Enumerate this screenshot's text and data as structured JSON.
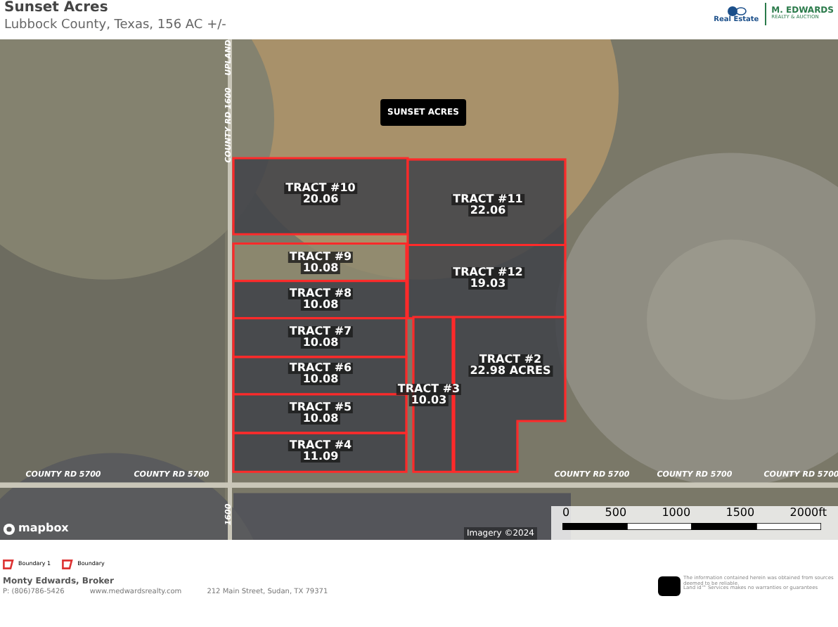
{
  "header": {
    "title": "Sunset Acres",
    "subtitle": "Lubbock County, Texas, 156 AC +/-",
    "logo_left": "Real Estate",
    "logo_right": [
      "M. EDWARDS",
      "REALTY & AUCTION"
    ]
  },
  "map": {
    "place_label": "SUNSET ACRES",
    "tracts": [
      {
        "name": "TRACT #10",
        "acres": "20.06"
      },
      {
        "name": "TRACT #11",
        "acres": "22.06"
      },
      {
        "name": "TRACT #9",
        "acres": "10.08"
      },
      {
        "name": "TRACT #12",
        "acres": "19.03"
      },
      {
        "name": "TRACT #8",
        "acres": "10.08"
      },
      {
        "name": "TRACT #7",
        "acres": "10.08"
      },
      {
        "name": "TRACT #2",
        "acres": "22.98 ACRES"
      },
      {
        "name": "TRACT #6",
        "acres": "10.08"
      },
      {
        "name": "TRACT #3",
        "acres": "10.03"
      },
      {
        "name": "TRACT #5",
        "acres": "10.08"
      },
      {
        "name": "TRACT #4",
        "acres": "11.09"
      }
    ],
    "road_labels": [
      {
        "text": "UPLAND",
        "kind": "vertical"
      },
      {
        "text": "COUNTY RD 1600",
        "kind": "vertical"
      },
      {
        "text": "COUNTY RD 5700",
        "kind": "horizontal"
      },
      {
        "text": "COUNTY RD 5700",
        "kind": "horizontal"
      },
      {
        "text": "COUNTY RD 5700",
        "kind": "horizontal"
      },
      {
        "text": "COUNTY RD 5700",
        "kind": "horizontal"
      },
      {
        "text": "COUNTY RD 5700",
        "kind": "horizontal"
      },
      {
        "text": "1600",
        "kind": "vertical"
      }
    ],
    "attribution": "mapbox",
    "imagery": "Imagery ©2024",
    "scale_bar": [
      "0",
      "500",
      "1000",
      "1500",
      "2000ft"
    ]
  },
  "legend": [
    {
      "label": "Boundary 1"
    },
    {
      "label": "Boundary"
    }
  ],
  "footer": {
    "name": "Monty Edwards, Broker",
    "phone": "P: (806)786-5426",
    "website": "www.medwardsrealty.com",
    "address": "212 Main Street, Sudan, TX 79371",
    "disclaimer": [
      "The information contained herein was obtained from sources deemed to be reliable.",
      "Land id™ Services makes no warranties or guarantees"
    ]
  }
}
